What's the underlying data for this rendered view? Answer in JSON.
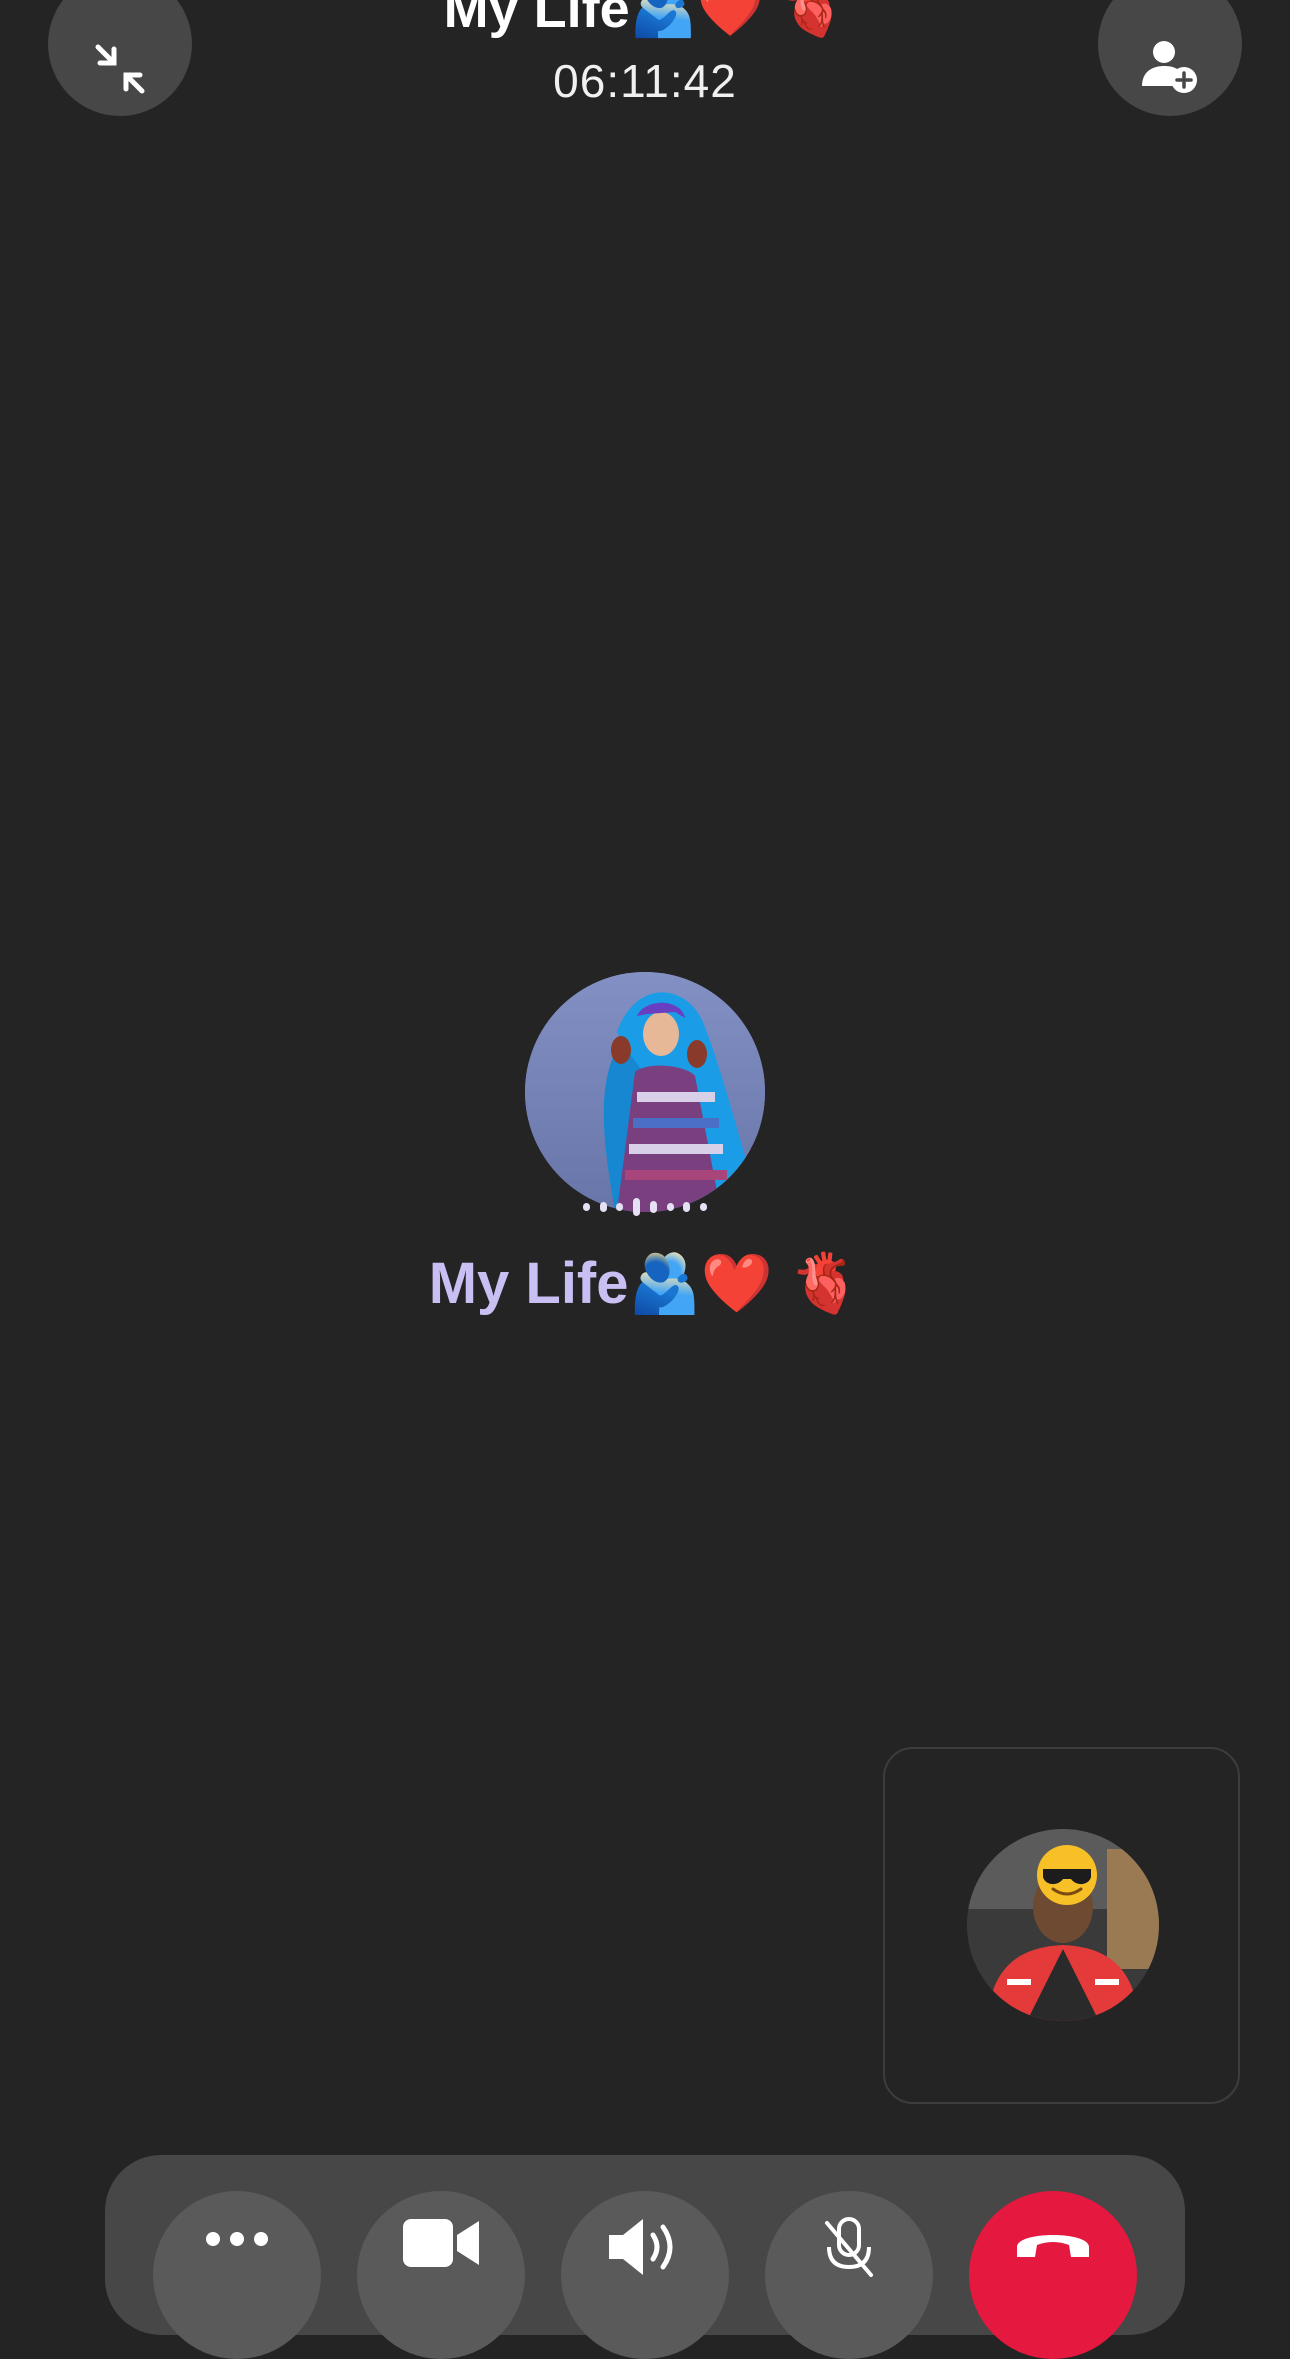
{
  "header": {
    "title": "My Life🫂❤️ 🫀",
    "timer": "06:11:42"
  },
  "callee": {
    "name": "My Life🫂❤️ 🫀"
  },
  "icons": {
    "minimize": "minimize-arrows-icon",
    "add_participant": "add-person-icon",
    "more": "more-dots-icon",
    "video": "video-camera-icon",
    "speaker": "speaker-volume-icon",
    "mute": "microphone-muted-icon",
    "end_call": "end-call-icon"
  },
  "colors": {
    "background": "#242424",
    "button": "#474747",
    "callee_name": "#c9bff2",
    "end_call": "#e5183f"
  }
}
